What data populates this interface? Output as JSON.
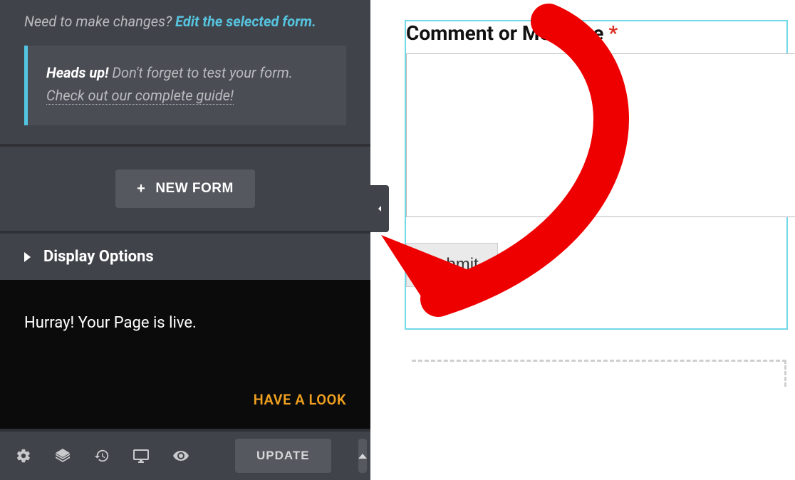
{
  "sidebar": {
    "prompt_prefix": "Need to make changes? ",
    "prompt_link": "Edit the selected form.",
    "heads_up": {
      "title": "Heads up!",
      "body_before_link": " Don't forget to test your form. ",
      "guide_link": "Check out our complete guide!"
    },
    "new_form_label": "NEW FORM",
    "display_options_label": "Display Options",
    "live_message": "Hurray! Your Page is live.",
    "have_a_look_label": "HAVE A LOOK",
    "footer": {
      "update_label": "UPDATE"
    }
  },
  "preview": {
    "field_label": "Comment or Message",
    "required_marker": "*",
    "submit_label": "Submit"
  }
}
